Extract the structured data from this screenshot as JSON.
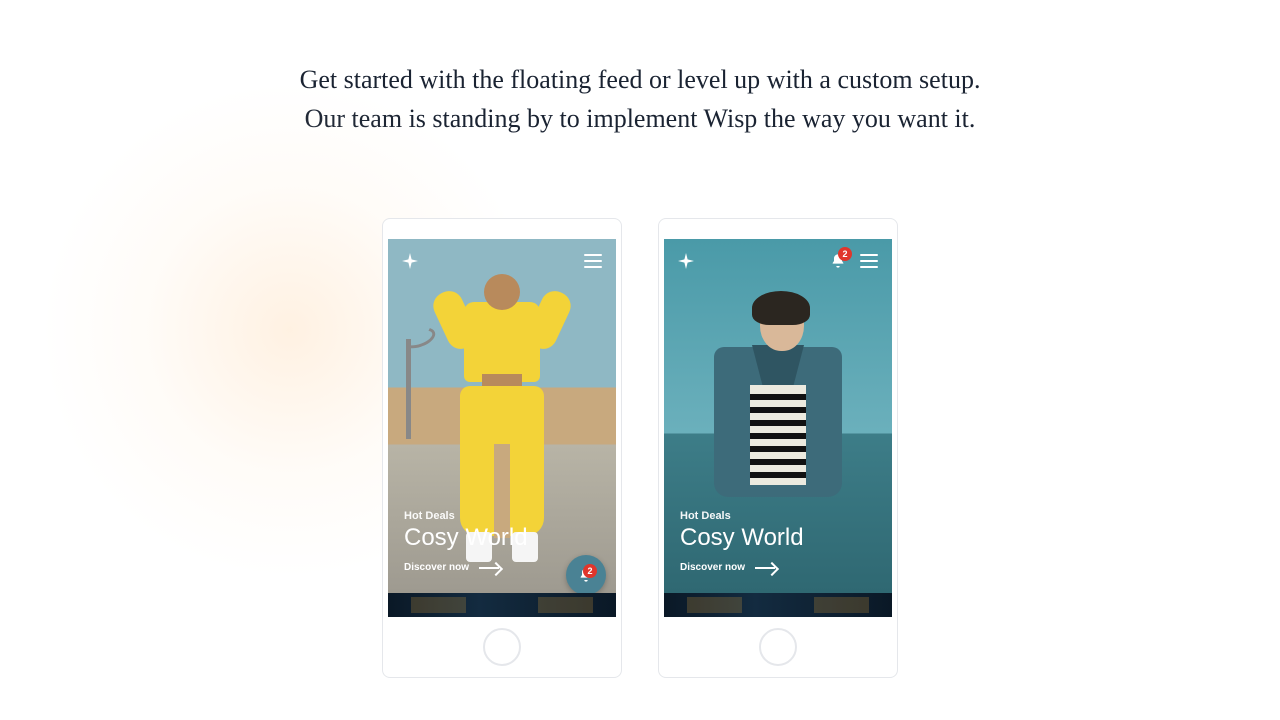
{
  "headline": {
    "line1": "Get started with the floating feed or level up with a custom setup.",
    "line2": "Our team is standing by to implement Wisp the way you want it."
  },
  "phones": [
    {
      "variant": "floating-fab",
      "nav_bell_in_header": false,
      "badge_count": "2",
      "hero": {
        "eyebrow": "Hot Deals",
        "title": "Cosy World",
        "cta": "Discover now"
      }
    },
    {
      "variant": "header-bell",
      "nav_bell_in_header": true,
      "badge_count": "2",
      "hero": {
        "eyebrow": "Hot Deals",
        "title": "Cosy World",
        "cta": "Discover now"
      }
    }
  ],
  "icons": {
    "sparkle": "sparkle-icon",
    "hamburger": "hamburger-icon",
    "bell": "bell-icon",
    "arrow_right": "arrow-right-icon"
  },
  "colors": {
    "text_dark": "#1a2332",
    "badge_red": "#e0362c",
    "fab_bg": "#4a8294"
  }
}
